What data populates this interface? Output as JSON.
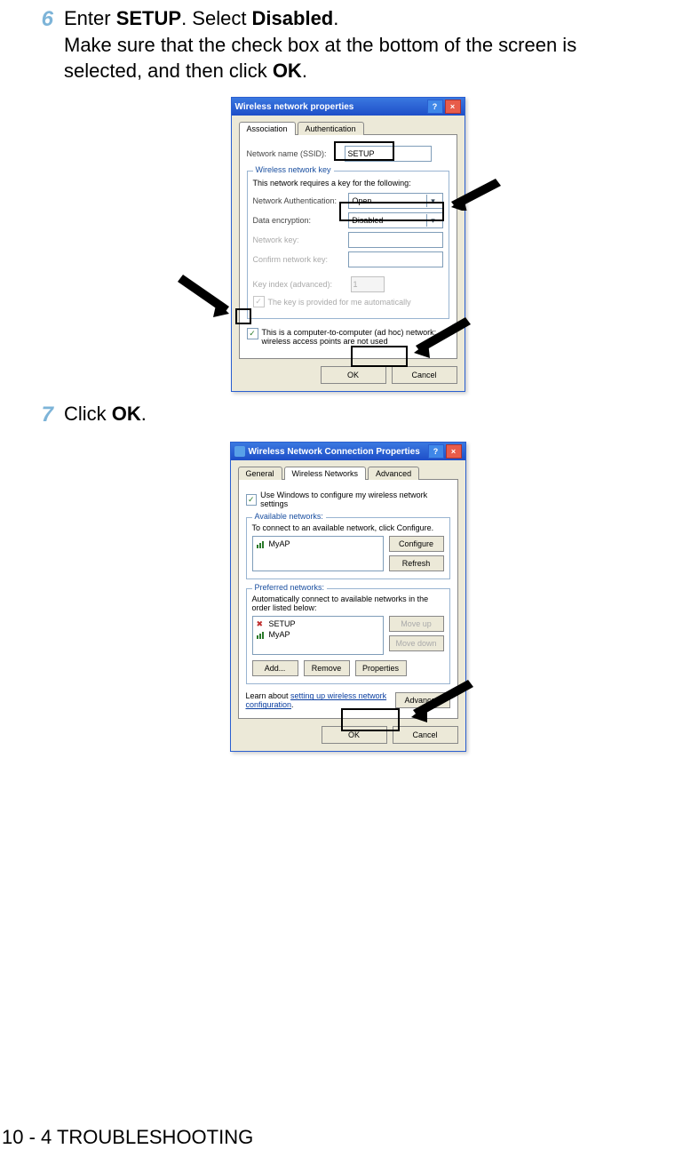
{
  "step6": {
    "num": "6",
    "text_a": "Enter ",
    "bold_a": "SETUP",
    "text_b": ". Select ",
    "bold_b": "Disabled",
    "text_c": ".",
    "line2_a": "Make sure that the check box at the bottom of the screen is selected, and then click ",
    "bold_c": "OK",
    "line2_b": "."
  },
  "step7": {
    "num": "7",
    "text_a": "Click ",
    "bold_a": "OK",
    "text_b": "."
  },
  "footer": "10 - 4 TROUBLESHOOTING",
  "dlg1": {
    "title": "Wireless network properties",
    "tab_assoc": "Association",
    "tab_auth": "Authentication",
    "ssid_label": "Network name (SSID):",
    "ssid_value": "SETUP",
    "grp_key": "Wireless network key",
    "key_desc": "This network requires a key for the following:",
    "auth_label": "Network Authentication:",
    "auth_value": "Open",
    "enc_label": "Data encryption:",
    "enc_value": "Disabled",
    "netkey_label": "Network key:",
    "confirm_label": "Confirm network key:",
    "keyidx_label": "Key index (advanced):",
    "keyidx_value": "1",
    "autokey": "The key is provided for me automatically",
    "adhoc": "This is a computer-to-computer (ad hoc) network; wireless access points are not used",
    "ok": "OK",
    "cancel": "Cancel"
  },
  "dlg2": {
    "title": "Wireless Network Connection Properties",
    "tab_general": "General",
    "tab_wn": "Wireless Networks",
    "tab_adv": "Advanced",
    "use_win": "Use Windows to configure my wireless network settings",
    "avail_legend": "Available networks:",
    "avail_desc": "To connect to an available network, click Configure.",
    "ap1": "MyAP",
    "configure": "Configure",
    "refresh": "Refresh",
    "pref_legend": "Preferred networks:",
    "pref_desc": "Automatically connect to available networks in the order listed below:",
    "pn1": "SETUP",
    "pn2": "MyAP",
    "moveup": "Move up",
    "movedown": "Move down",
    "add": "Add...",
    "remove": "Remove",
    "properties": "Properties",
    "learn_a": "Learn about ",
    "learn_link": "setting up wireless network configuration",
    "learn_b": ".",
    "advanced": "Advanced",
    "ok": "OK",
    "cancel": "Cancel"
  }
}
